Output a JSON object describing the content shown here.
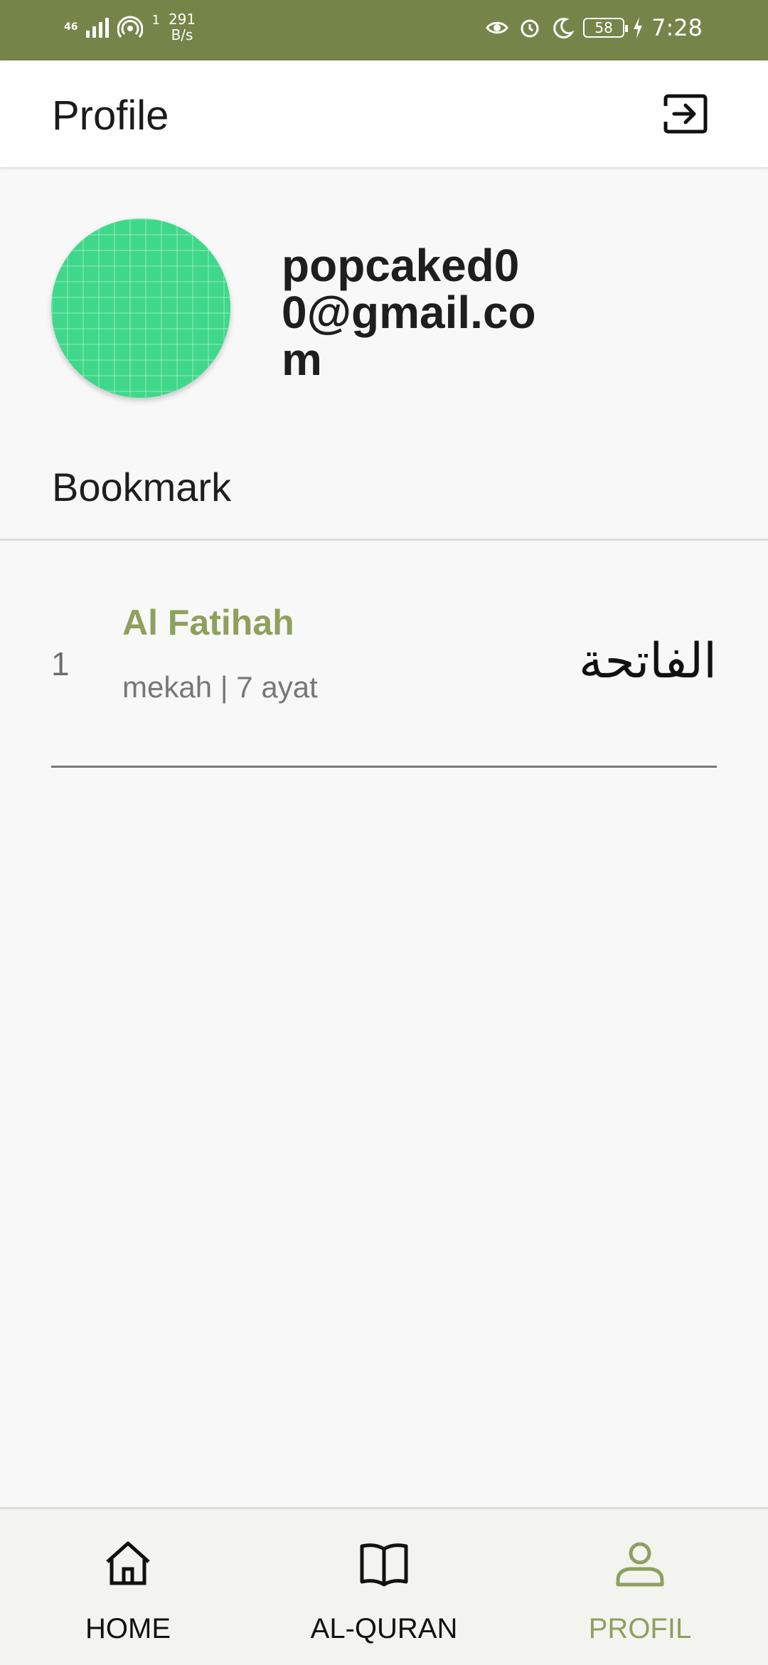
{
  "status_bar": {
    "network_type": "46",
    "wifi_badge": "1",
    "speed_value": "291",
    "speed_unit": "B/s",
    "battery": "58",
    "time": "7:28"
  },
  "app_bar": {
    "title": "Profile",
    "logout_icon": "logout-icon"
  },
  "profile": {
    "email": "popcaked00@gmail.com",
    "avatar_color": "#3fd88a"
  },
  "bookmarks": {
    "section_title": "Bookmark",
    "items": [
      {
        "number": "1",
        "name": "Al Fatihah",
        "meta": "mekah | 7 ayat",
        "arabic": "الفاتحة"
      }
    ]
  },
  "bottom_nav": {
    "items": [
      {
        "label": "HOME",
        "icon": "home-icon",
        "active": false
      },
      {
        "label": "AL-QURAN",
        "icon": "book-icon",
        "active": false
      },
      {
        "label": "PROFIL",
        "icon": "user-icon",
        "active": true
      }
    ]
  },
  "colors": {
    "status_bar": "#75854a",
    "accent": "#8ea05e"
  }
}
